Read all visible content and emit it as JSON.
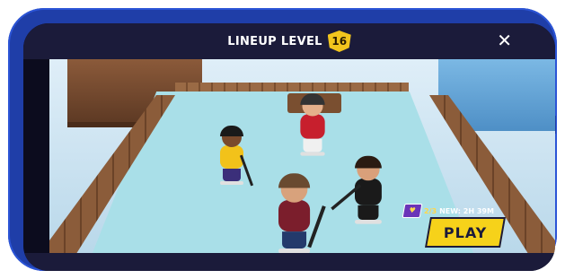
{
  "header": {
    "title": "LINEUP LEVEL",
    "level": "16",
    "close_icon": "close-icon"
  },
  "lineup": {
    "new_count": "2/3",
    "new_timer": "NEW: 2H 39M",
    "badge_icon": "shield-badge-icon",
    "play_label": "PLAY"
  },
  "colors": {
    "phone_frame": "#1f3ea8",
    "bar": "#1b1b3a",
    "accent_yellow": "#f6d21a",
    "badge_purple": "#6a34b8",
    "ice": "#a9dfe8"
  }
}
